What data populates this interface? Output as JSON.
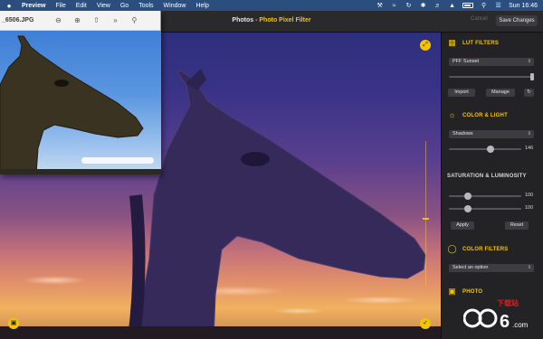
{
  "menubar": {
    "items": [
      "Preview",
      "File",
      "Edit",
      "View",
      "Go",
      "Tools",
      "Window",
      "Help"
    ],
    "status_icons": [
      "wifi-icon",
      "sync-icon",
      "bluetooth-icon",
      "volume-icon",
      "airplay-icon",
      "search-icon",
      "control-center-icon",
      "siri-icon"
    ],
    "clock": "Sun 16:46"
  },
  "window": {
    "title_app": "Photos",
    "title_separator": " - ",
    "title_ext": "Photo Pixel Filter",
    "cancel_label": "Cancel",
    "save_label": "Save Changes"
  },
  "preview": {
    "filename": "_6506.JPG",
    "tools": [
      "zoom-out-icon",
      "zoom-in-icon",
      "share-icon",
      "more-icon",
      "search-icon"
    ]
  },
  "panel": {
    "lut": {
      "title": "LUT FILTERS",
      "selected": "PFF Sunset",
      "import_label": "Import",
      "manage_label": "Manage",
      "slider_fraction": 1.0
    },
    "color_light": {
      "title": "COLOR & LIGHT",
      "selected": "Shadows",
      "value": "146",
      "fraction": 0.57
    },
    "saturation": {
      "title": "SATURATION & LUMINOSITY",
      "sat_value": "100",
      "lum_value": "100",
      "sat_fraction": 0.26,
      "lum_fraction": 0.26,
      "apply_label": "Apply",
      "reset_label": "Reset"
    },
    "color_filters": {
      "title": "COLOR FILTERS",
      "selected": "Select an option"
    },
    "photo": {
      "title": "PHOTO"
    }
  },
  "watermark": {
    "text": "下载站"
  },
  "colors": {
    "accent": "#f5c400",
    "panel_bg": "#232326",
    "menubar_bg": "#2b4e7e"
  }
}
